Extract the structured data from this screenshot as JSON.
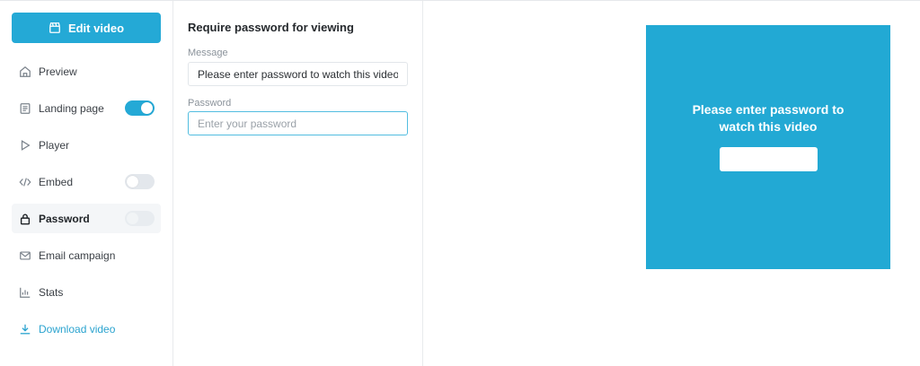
{
  "sidebar": {
    "edit_button": "Edit video",
    "items": [
      {
        "label": "Preview",
        "icon": "home-icon"
      },
      {
        "label": "Landing page",
        "icon": "page-icon",
        "toggle": "on"
      },
      {
        "label": "Player",
        "icon": "play-icon"
      },
      {
        "label": "Embed",
        "icon": "code-icon",
        "toggle": "off"
      },
      {
        "label": "Password",
        "icon": "lock-icon",
        "toggle": "disabled",
        "active": true
      },
      {
        "label": "Email campaign",
        "icon": "mail-icon"
      },
      {
        "label": "Stats",
        "icon": "stats-icon"
      },
      {
        "label": "Download video",
        "icon": "download-icon"
      }
    ]
  },
  "settings": {
    "title": "Require password for viewing",
    "message_label": "Message",
    "message_value": "Please enter password to watch this video",
    "password_label": "Password",
    "password_placeholder": "Enter your password"
  },
  "preview": {
    "message": "Please enter password to watch this video",
    "background_color": "#22a9d4"
  },
  "colors": {
    "accent": "#24a9d6"
  }
}
